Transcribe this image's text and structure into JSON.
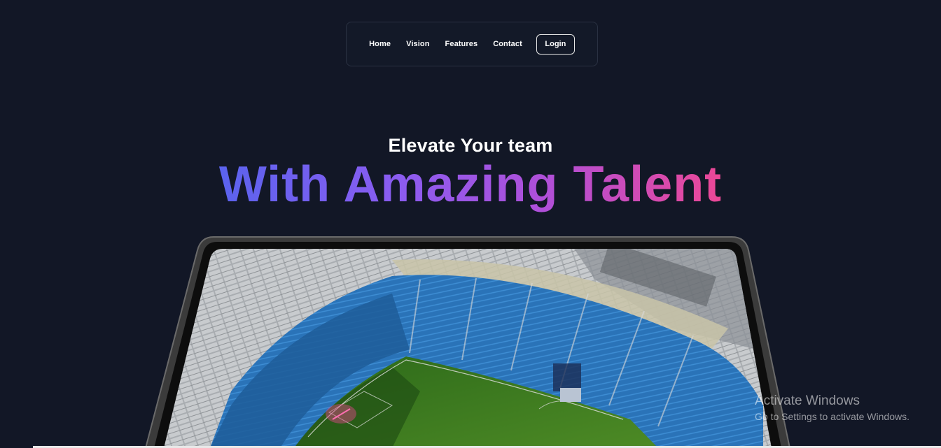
{
  "nav": {
    "items": [
      {
        "label": "Home"
      },
      {
        "label": "Vision"
      },
      {
        "label": "Features"
      },
      {
        "label": "Contact"
      }
    ],
    "login_label": "Login"
  },
  "hero": {
    "subtitle": "Elevate Your team",
    "title": "With Amazing Talent",
    "gradient_colors": [
      "#5b63ee",
      "#8a5cf0",
      "#b04fd8",
      "#ec4896"
    ],
    "image_subject": "stadium-aerial-photo"
  },
  "overlay": {
    "activate_title": "Activate Windows",
    "activate_sub": "Go to Settings to activate Windows."
  },
  "colors": {
    "background": "#121726",
    "nav_border": "#2a3142",
    "text": "#ffffff",
    "device_frame": "#4a4a4a",
    "stadium_seats": "#2f7fc4",
    "pitch": "#3a7a1e"
  }
}
